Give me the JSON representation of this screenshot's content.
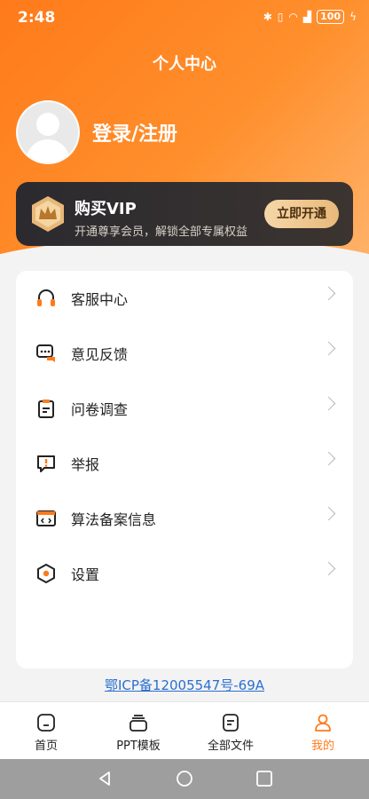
{
  "status": {
    "time": "2:48",
    "battery": "100"
  },
  "header": {
    "title": "个人中心"
  },
  "profile": {
    "login_text": "登录/注册"
  },
  "vip": {
    "title": "购买VIP",
    "subtitle": "开通尊享会员，解锁全部专属权益",
    "button": "立即开通"
  },
  "menu": {
    "items": [
      {
        "label": "客服中心",
        "icon": "headset-icon"
      },
      {
        "label": "意见反馈",
        "icon": "feedback-icon"
      },
      {
        "label": "问卷调查",
        "icon": "clipboard-icon"
      },
      {
        "label": "举报",
        "icon": "report-icon"
      },
      {
        "label": "算法备案信息",
        "icon": "code-window-icon"
      },
      {
        "label": "设置",
        "icon": "settings-icon"
      }
    ]
  },
  "icp": "鄂ICP备12005547号-69A",
  "tabs": [
    {
      "label": "首页",
      "active": false
    },
    {
      "label": "PPT模板",
      "active": false
    },
    {
      "label": "全部文件",
      "active": false
    },
    {
      "label": "我的",
      "active": true
    }
  ],
  "colors": {
    "accent": "#ff7a1a",
    "link": "#2a6fd1"
  }
}
